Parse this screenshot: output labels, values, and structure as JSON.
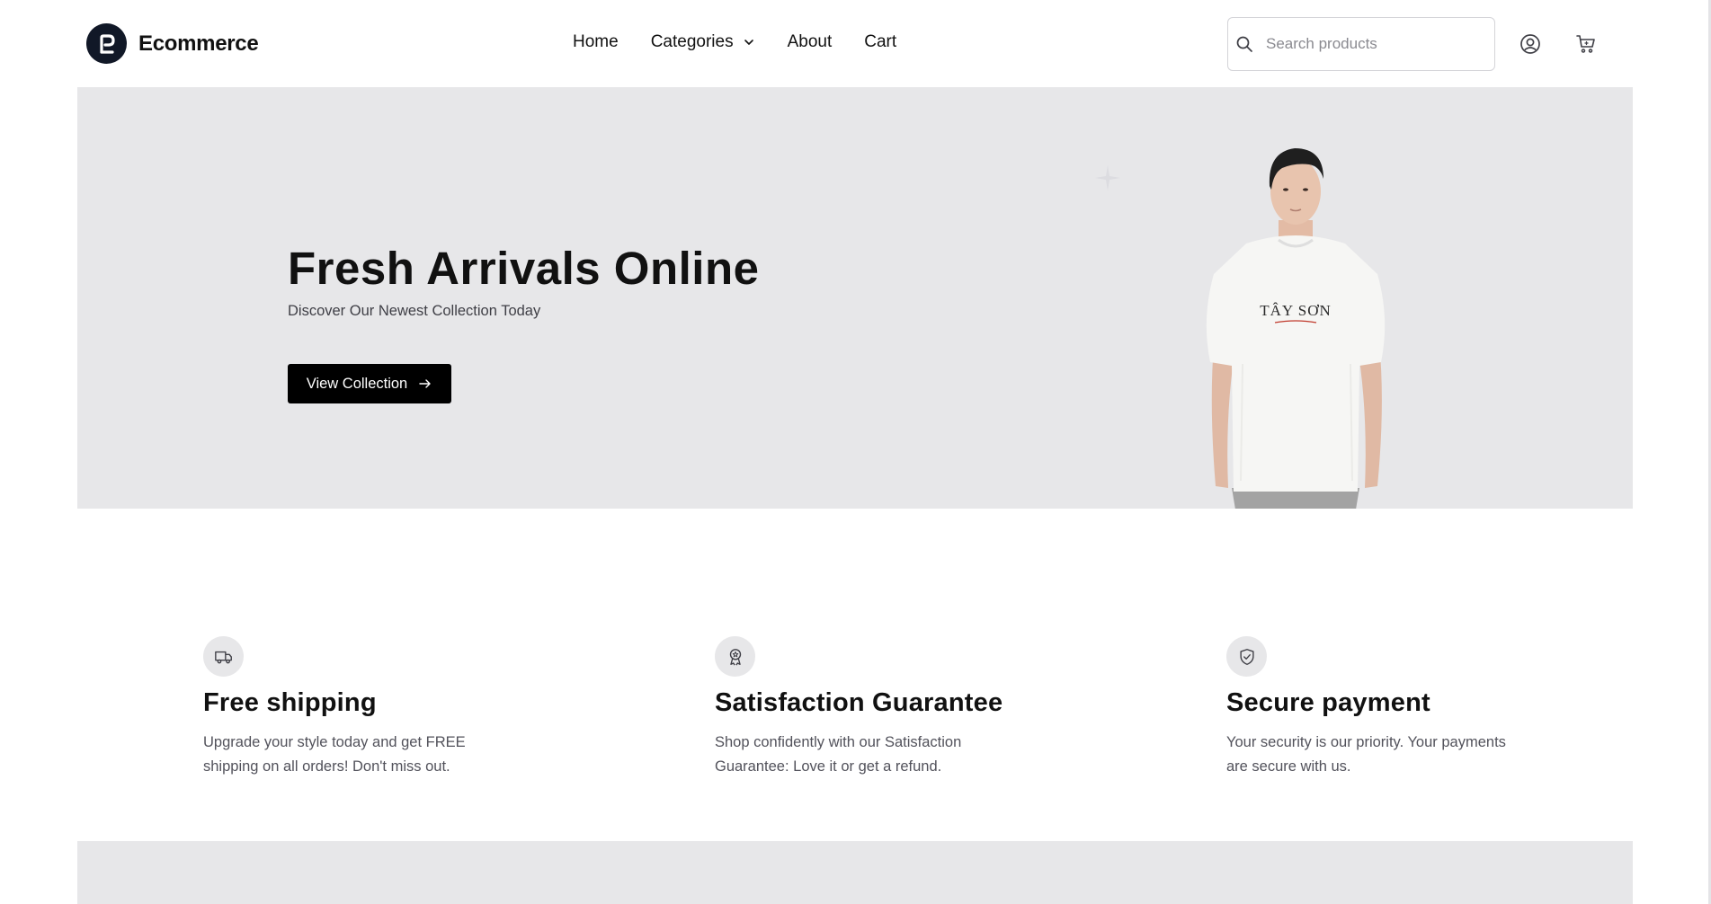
{
  "brand": {
    "name": "Ecommerce"
  },
  "nav": {
    "home": "Home",
    "categories": "Categories",
    "about": "About",
    "cart": "Cart"
  },
  "search": {
    "placeholder": "Search products",
    "value": ""
  },
  "hero": {
    "title": "Fresh Arrivals Online",
    "subtitle": "Discover Our Newest Collection Today",
    "cta": "View Collection",
    "shirt_print": "TÂY SƠN"
  },
  "features": [
    {
      "icon": "truck-icon",
      "title": "Free shipping",
      "description": "Upgrade your style today and get FREE shipping on all orders! Don't miss out."
    },
    {
      "icon": "award-icon",
      "title": "Satisfaction Guarantee",
      "description": "Shop confidently with our Satisfaction Guarantee: Love it or get a refund."
    },
    {
      "icon": "shield-check-icon",
      "title": "Secure payment",
      "description": "Your security is our priority. Your payments are secure with us."
    }
  ],
  "colors": {
    "accent": "#000000",
    "hero_background": "#e7e7e9",
    "logo_background": "#111827",
    "muted_text": "#52525b"
  }
}
